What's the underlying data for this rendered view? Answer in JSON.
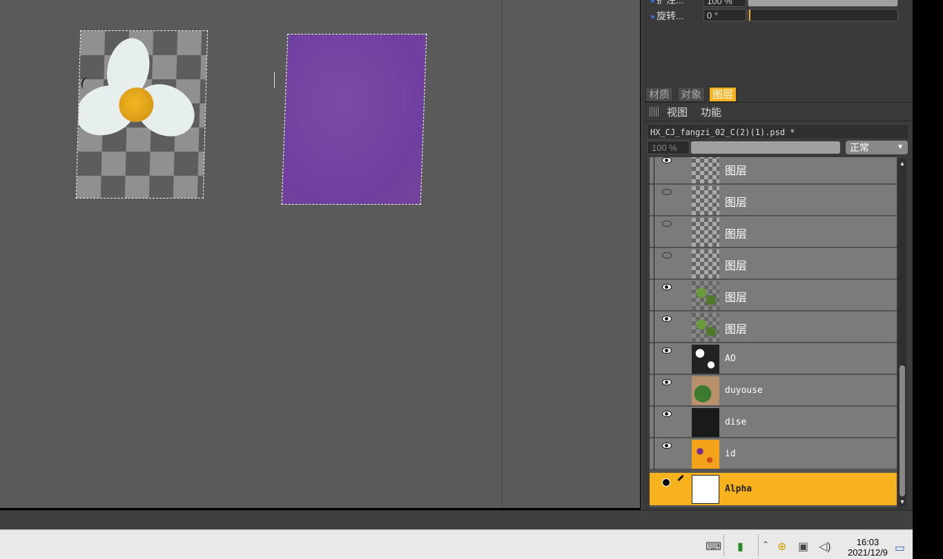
{
  "properties": {
    "row1": {
      "label": "扩注...",
      "value": "100 %"
    },
    "row2": {
      "label": "旋转...",
      "value": "0 °"
    }
  },
  "tabs": [
    "材质",
    "对象",
    "图层"
  ],
  "active_tab": "图层",
  "menu": {
    "view": "视图",
    "function": "功能"
  },
  "document": {
    "filename": "HX_CJ_fangzi_02_C(2)(1).psd *"
  },
  "opacity": "100 %",
  "blend_mode": "正常",
  "layers": [
    {
      "name": "图层",
      "visible": true
    },
    {
      "name": "图层",
      "visible": false
    },
    {
      "name": "图层",
      "visible": false
    },
    {
      "name": "图层",
      "visible": false
    },
    {
      "name": "图层",
      "visible": true
    },
    {
      "name": "图层",
      "visible": true
    },
    {
      "name": "AO",
      "visible": true
    },
    {
      "name": "duyouse",
      "visible": true
    },
    {
      "name": "dise",
      "visible": true
    },
    {
      "name": "id",
      "visible": true
    },
    {
      "name": "Alpha",
      "visible": true,
      "selected": true
    }
  ],
  "clock": {
    "time": "16:03",
    "date": "2021/12/9"
  }
}
